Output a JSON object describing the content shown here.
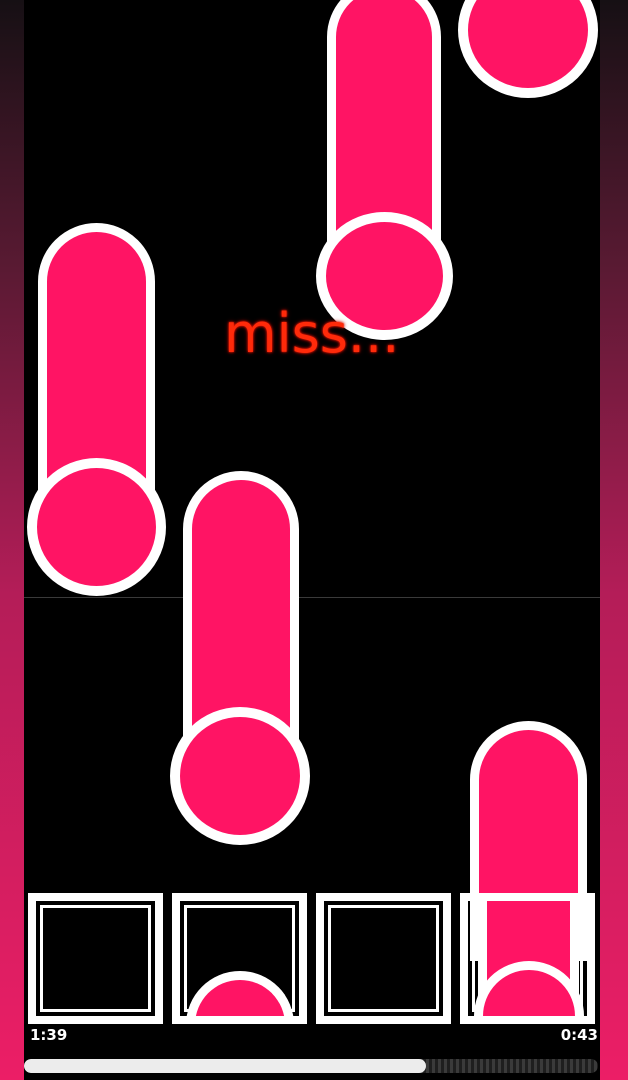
{
  "game": {
    "judgement_text": "miss...",
    "time_elapsed": "1:39",
    "time_remaining": "0:43",
    "progress_fraction": 0.7,
    "lane_count": 4
  },
  "colors": {
    "note_fill": "#ff1464",
    "note_outline": "#ffffff",
    "miss_text": "#ff2a0a",
    "background": "#000000",
    "side_gradient_bottom": "#ec1e66"
  },
  "icons": {
    "note": "hold-note-icon",
    "receptor": "lane-receptor-icon"
  }
}
